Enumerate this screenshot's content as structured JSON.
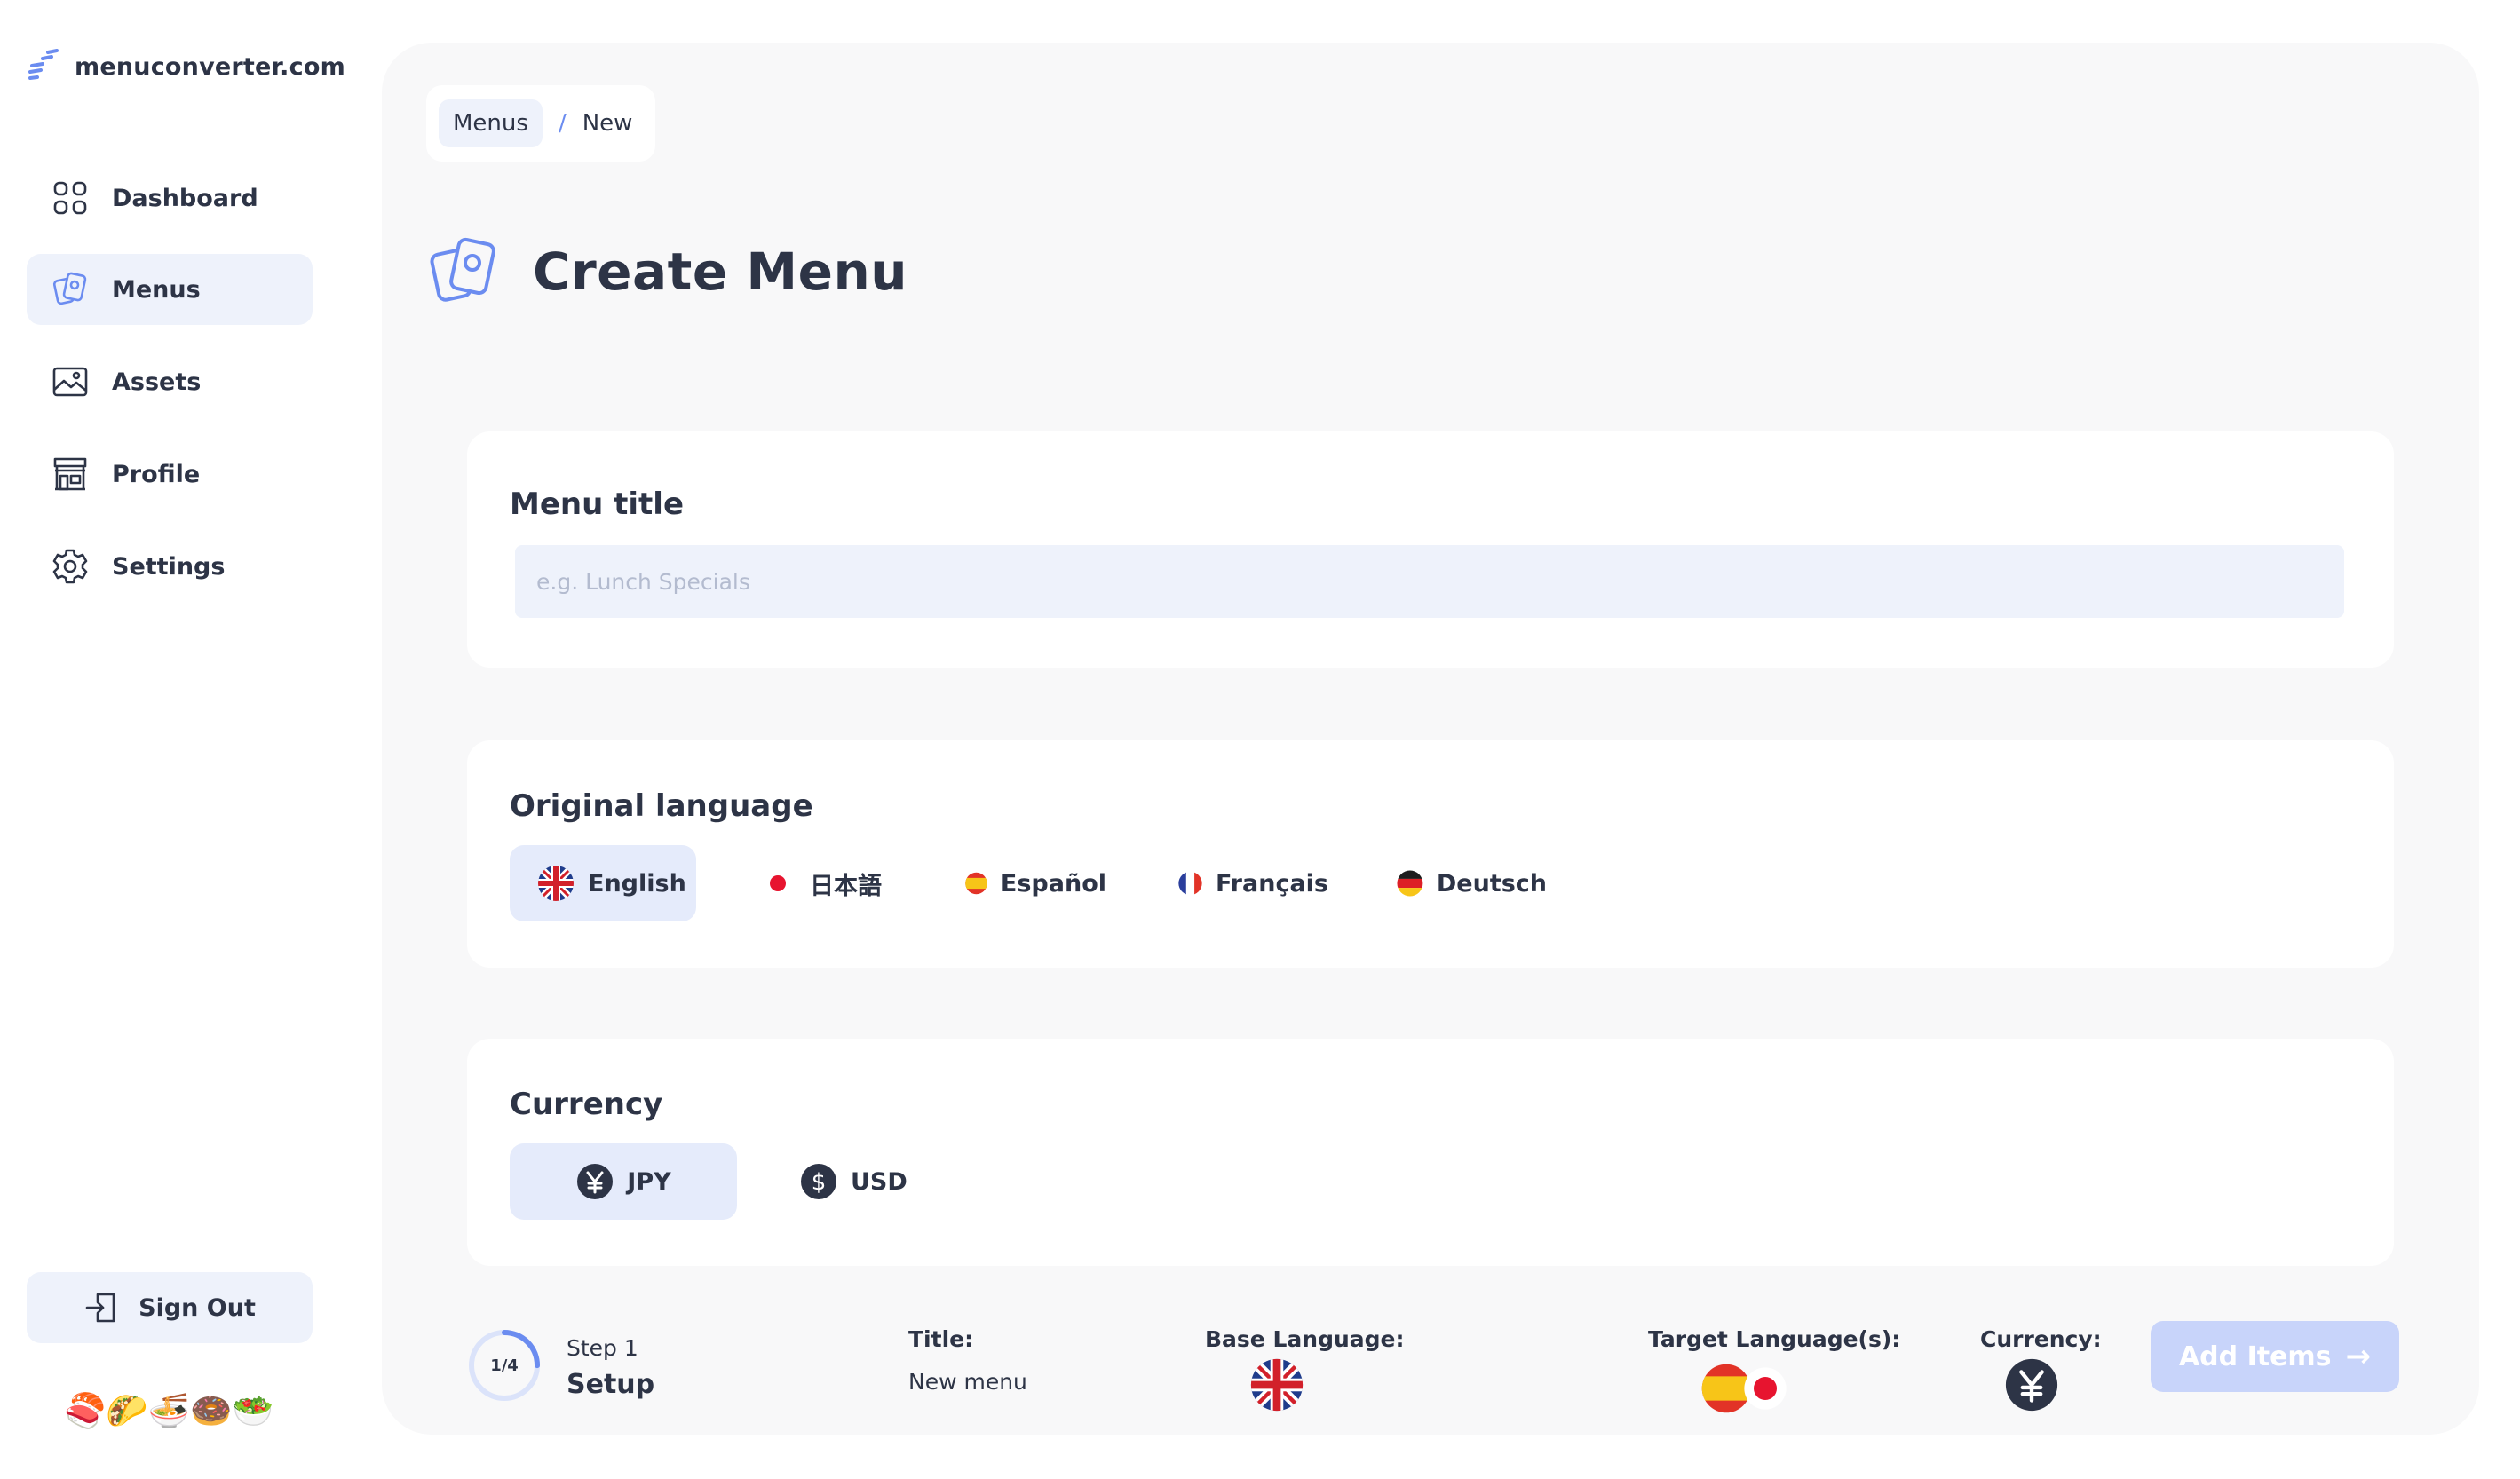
{
  "brand": {
    "name": "menuconverter.com",
    "accent": "#6b8cf0"
  },
  "sidebar": {
    "items": [
      {
        "label": "Dashboard",
        "icon": "grid-icon",
        "active": false
      },
      {
        "label": "Menus",
        "icon": "cards-icon",
        "active": true
      },
      {
        "label": "Assets",
        "icon": "image-icon",
        "active": false
      },
      {
        "label": "Profile",
        "icon": "store-icon",
        "active": false
      },
      {
        "label": "Settings",
        "icon": "gear-icon",
        "active": false
      }
    ],
    "sign_out": "Sign Out",
    "food_emojis": "🍣🌮🍜🍩🥗"
  },
  "breadcrumb": {
    "parent": "Menus",
    "separator": "/",
    "current": "New"
  },
  "page": {
    "title": "Create Menu"
  },
  "menu_title": {
    "label": "Menu title",
    "value": "",
    "placeholder": "e.g. Lunch Specials"
  },
  "original_language": {
    "label": "Original language",
    "options": [
      {
        "label": "English",
        "icon": "uk-flag-icon",
        "selected": true
      },
      {
        "label": "日本語",
        "icon": "japan-flag-icon",
        "selected": false
      },
      {
        "label": "Español",
        "icon": "spain-flag-icon",
        "selected": false
      },
      {
        "label": "Français",
        "icon": "france-flag-icon",
        "selected": false
      },
      {
        "label": "Deutsch",
        "icon": "germany-flag-icon",
        "selected": false
      }
    ]
  },
  "currency": {
    "label": "Currency",
    "options": [
      {
        "label": "JPY",
        "icon": "yen-icon",
        "selected": true
      },
      {
        "label": "USD",
        "icon": "dollar-icon",
        "selected": false
      }
    ]
  },
  "footer": {
    "progress": "1/4",
    "progress_fraction": 0.25,
    "step_number": "Step 1",
    "step_name": "Setup",
    "title_label": "Title:",
    "title_value": "New menu",
    "base_language_label": "Base Language:",
    "target_languages_label": "Target Language(s):",
    "currency_label": "Currency:",
    "add_items_label": "Add Items",
    "add_items_arrow": "→"
  }
}
